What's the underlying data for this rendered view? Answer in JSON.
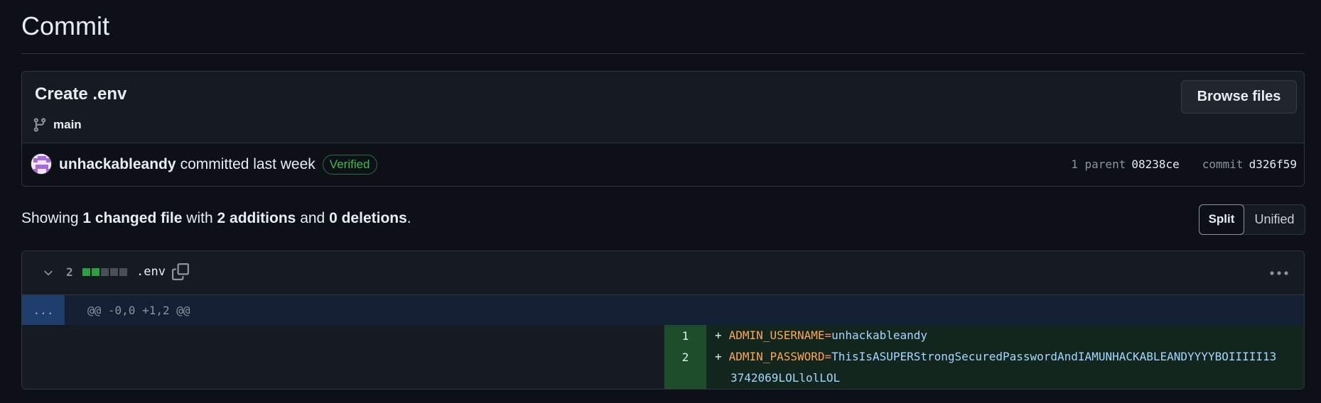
{
  "page": {
    "title": "Commit"
  },
  "commit": {
    "message": "Create .env",
    "branch": "main",
    "browse_label": "Browse files",
    "author": "unhackableandy",
    "action": "committed last week",
    "verified_label": "Verified",
    "parent_label": "1 parent",
    "parent_hash": "08238ce",
    "commit_label": "commit",
    "commit_hash": "d326f59"
  },
  "summary": {
    "showing": "Showing",
    "changed": "1 changed file",
    "with": "with",
    "additions": "2 additions",
    "and": "and",
    "deletions": "0 deletions",
    "period": "."
  },
  "view_toggle": {
    "split": "Split",
    "unified": "Unified",
    "selected": "Split"
  },
  "diff": {
    "file_count": "2",
    "file_name": ".env",
    "diffstat": [
      "added",
      "added",
      "neutral",
      "neutral",
      "neutral"
    ],
    "hunk_expand": "...",
    "hunk_header": "@@ -0,0 +1,2 @@",
    "lines": [
      {
        "num": "1",
        "sign": "+",
        "key": "ADMIN_USERNAME",
        "eq": "=",
        "value": "unhackableandy"
      },
      {
        "num": "2",
        "sign": "+",
        "key": "ADMIN_PASSWORD",
        "eq": "=",
        "value": "ThisIsASUPERStrongSecuredPasswordAndIAMUNHACKABLEANDYYYYBOIIIII13",
        "continuation": "3742069LOLlolLOL"
      }
    ]
  },
  "colors": {
    "added": "#2ea043",
    "neutral": "#484f58",
    "verified": "#3fb950"
  }
}
